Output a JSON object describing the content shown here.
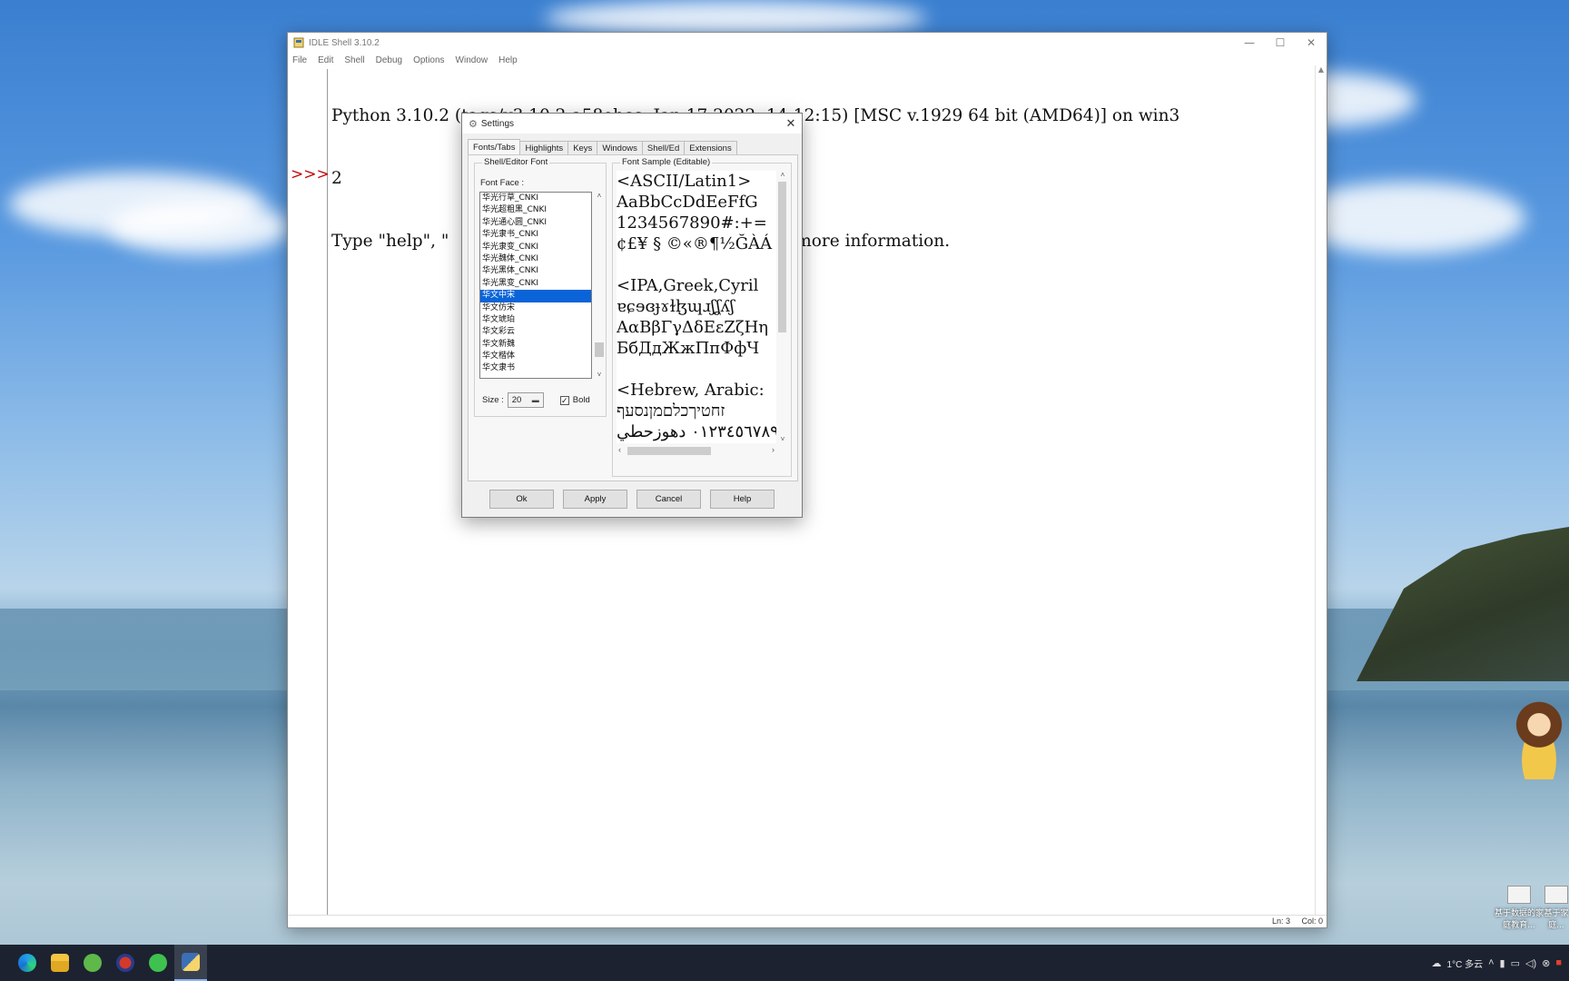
{
  "idle": {
    "title": "IDLE Shell 3.10.2",
    "menu": [
      "File",
      "Edit",
      "Shell",
      "Debug",
      "Options",
      "Window",
      "Help"
    ],
    "controls": {
      "minimize": "—",
      "maximize": "☐",
      "close": "✕"
    },
    "banner_line1": "Python 3.10.2 (tags/v3.10.2:a58ebcc, Jan 17 2022, 14:12:15) [MSC v.1929 64 bit (AMD64)] on win3",
    "banner_line2": "2",
    "banner_line3_start": "Type \"help\", \"",
    "banner_line3_end": "or more information.",
    "prompt": ">>>",
    "status": {
      "ln": "Ln: 3",
      "col": "Col: 0"
    }
  },
  "settings": {
    "title": "Settings",
    "close": "✕",
    "tabs": [
      "Fonts/Tabs",
      "Highlights",
      "Keys",
      "Windows",
      "Shell/Ed",
      "Extensions"
    ],
    "active_tab": "Fonts/Tabs",
    "shell_editor_font_legend": "Shell/Editor Font",
    "font_face_label": "Font Face :",
    "font_list": [
      "华光行草_CNKI",
      "华光超粗黑_CNKI",
      "华光通心圆_CNKI",
      "华光隶书_CNKI",
      "华光隶变_CNKI",
      "华光魏体_CNKI",
      "华光黑体_CNKI",
      "华光黑变_CNKI",
      "华文中宋",
      "华文仿宋",
      "华文琥珀",
      "华文彩云",
      "华文新魏",
      "华文楷体",
      "华文隶书"
    ],
    "selected_font": "华文中宋",
    "size_label": "Size :",
    "size_value": "20",
    "bold_label": "Bold",
    "bold_checked": true,
    "font_sample_legend": "Font Sample (Editable)",
    "sample_lines": [
      "<ASCII/Latin1>",
      "AaBbCcDdEeFfG",
      "1234567890#:+=",
      "¢£¥ § ©«®¶½ĞÀÁ",
      "",
      "<IPA,Greek,Cyril",
      "ɐɕɘɞɟɤɫɮɰɹʃʆʎʃ",
      "ΑαΒβΓγΔδΕεΖζΗη",
      "БбДдЖжПпФфЧ",
      "",
      "<Hebrew, Arabic:",
      "זחטיךכלםמןנסעף",
      "٠١٢٣٤٥٦٧٨٩ دهوزحطي"
    ],
    "buttons": {
      "ok": "Ok",
      "apply": "Apply",
      "cancel": "Cancel",
      "help": "Help"
    }
  },
  "taskbar": {
    "apps": [
      "edge-icon",
      "file-explorer-icon",
      "app-green-icon",
      "app-red-icon",
      "wechat-icon",
      "idle-python-icon"
    ],
    "weather": "1°C 多云"
  },
  "desktop": {
    "icon_label_1": "基于数据的家庭教育...",
    "icon_label_2": "基于家庭..."
  },
  "colors": {
    "selection": "#0a64d8",
    "prompt": "#c00000",
    "taskbar": "#1c2230"
  }
}
